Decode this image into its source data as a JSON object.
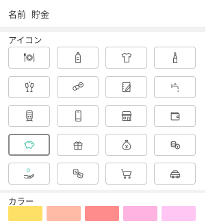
{
  "name_field": {
    "label": "名前",
    "value": "貯金"
  },
  "icon_section": {
    "title": "アイコン",
    "selected": "piggy-bank",
    "icons": [
      [
        "plate-cutlery",
        "baby-bottle",
        "t-shirt",
        "lipstick"
      ],
      [
        "cheers-glasses",
        "pills",
        "notebook-pen",
        "faucet"
      ],
      [
        "train",
        "smartphone",
        "shop",
        "wallet"
      ],
      [
        "piggy-bank",
        "gift",
        "money-bag",
        "coins"
      ],
      [
        "hand-coin",
        "dice",
        "shopping-cart",
        "car"
      ]
    ],
    "selected_color": "#5cc8b4"
  },
  "color_section": {
    "title": "カラー",
    "swatches": [
      "#ffe066",
      "#ffbba6",
      "#ff8c8c",
      "#ffb3e0",
      "#ffc6f4"
    ]
  }
}
